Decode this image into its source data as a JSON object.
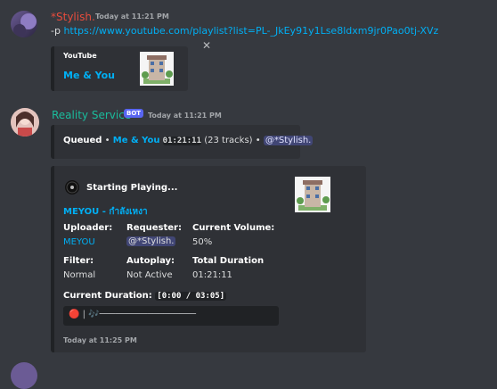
{
  "msg1": {
    "author": "*Stylish.",
    "timestamp": "Today at 11:21 PM",
    "prefix": "-p",
    "link": "https://www.youtube.com/playlist?list=PL-_JkEy91y1Lse8ldxm9jr0Pao0tj-XVz",
    "embed": {
      "provider": "YouTube",
      "title": "Me & You",
      "close_label": "✕"
    }
  },
  "msg2": {
    "author": "Reality Service",
    "bot_tag": "BOT",
    "timestamp": "Today at 11:21 PM",
    "queued": {
      "label": "Queued",
      "sep": "•",
      "playlist": "Me & You",
      "duration": "01:21:11",
      "tracks": "(23 tracks)",
      "sep2": "•",
      "mention": "@*Stylish."
    },
    "player": {
      "header": "Starting Playing...",
      "title": "MEYOU - กำลังเหงา",
      "fields": [
        {
          "name": "Uploader:",
          "value": "MEYOU",
          "link": true
        },
        {
          "name": "Requester:",
          "value": "@*Stylish.",
          "mention": true
        },
        {
          "name": "Current Volume:",
          "value": "50%"
        },
        {
          "name": "Filter:",
          "value": "Normal"
        },
        {
          "name": "Autoplay:",
          "value": "Not Active"
        },
        {
          "name": "Total Duration",
          "value": "01:21:11"
        }
      ],
      "current_duration_label": "Current Duration:",
      "current_duration_value": "[0:00 / 03:05]",
      "progress_line": "🔴 | 🎶──────────────────",
      "footer": "Today at 11:25 PM"
    }
  }
}
